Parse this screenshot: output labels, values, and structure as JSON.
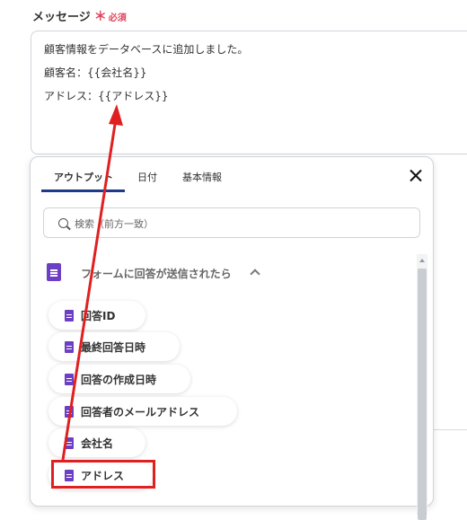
{
  "field": {
    "label": "メッセージ",
    "required_star": "＊",
    "required_text": "必須"
  },
  "message": {
    "lines": [
      "顧客情報をデータベースに追加しました。",
      "顧客名：{{会社名}}",
      "アドレス：{{アドレス}}"
    ]
  },
  "panel": {
    "tabs": [
      {
        "label": "アウトプット",
        "active": true
      },
      {
        "label": "日付",
        "active": false
      },
      {
        "label": "基本情報",
        "active": false
      }
    ],
    "search_placeholder": "検索（前方一致）",
    "section_title": "フォームに回答が送信されたら",
    "items": [
      {
        "label": "回答ID"
      },
      {
        "label": "最終回答日時"
      },
      {
        "label": "回答の作成日時"
      },
      {
        "label": "回答者のメールアドレス"
      },
      {
        "label": "会社名"
      },
      {
        "label": "アドレス"
      }
    ]
  },
  "colors": {
    "accent": "#1f3a8a",
    "required": "#e0445a",
    "doc_icon": "#6d3fc4",
    "annotation": "#e02020"
  },
  "icons": [
    "doc-icon",
    "search-icon",
    "close-icon",
    "chevron-up-icon"
  ]
}
